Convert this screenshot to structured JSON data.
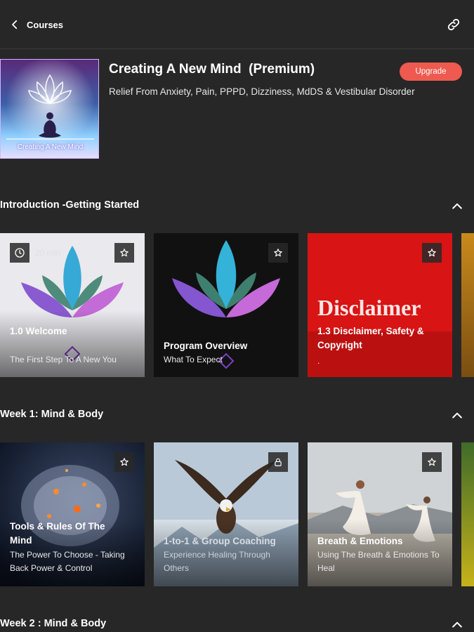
{
  "topbar": {
    "back_label": "Courses",
    "back_icon": "chevron-left-icon",
    "link_icon": "link-icon"
  },
  "course": {
    "title": "Creating A New Mind  (Premium)",
    "subtitle": "Relief From Anxiety, Pain, PPPD, Dizziness, MdDS & Vestibular Disorder",
    "thumb_caption": "Creating A New Mind",
    "upgrade_label": "Upgrade",
    "upgrade_color": "#ee5a4f"
  },
  "sections": [
    {
      "title": "Introduction -Getting Started",
      "cards": [
        {
          "title": "1.0 Welcome",
          "subtitle": "The First Step To A New You",
          "duration": "20 min"
        },
        {
          "title": "Program Overview",
          "subtitle": "What To Expect"
        },
        {
          "title": "1.3 Disclaimer, Safety & Copyright",
          "subtitle": ".",
          "art_text": "Disclaimer"
        }
      ]
    },
    {
      "title": "Week 1: Mind & Body",
      "cards": [
        {
          "title": "Tools & Rules Of The Mind",
          "subtitle": "The Power To Choose - Taking Back Power & Control"
        },
        {
          "title": "1-to-1 & Group Coaching",
          "subtitle": "Experience Healing Through Others",
          "locked": true
        },
        {
          "title": "Breath & Emotions",
          "subtitle": "Using The Breath & Emotions To Heal"
        }
      ]
    },
    {
      "title": "Week 2 : Mind & Body"
    }
  ],
  "icons": {
    "favorite": "star-outline-icon",
    "lock": "lock-icon",
    "clock": "clock-icon",
    "collapse": "chevron-up-icon"
  }
}
